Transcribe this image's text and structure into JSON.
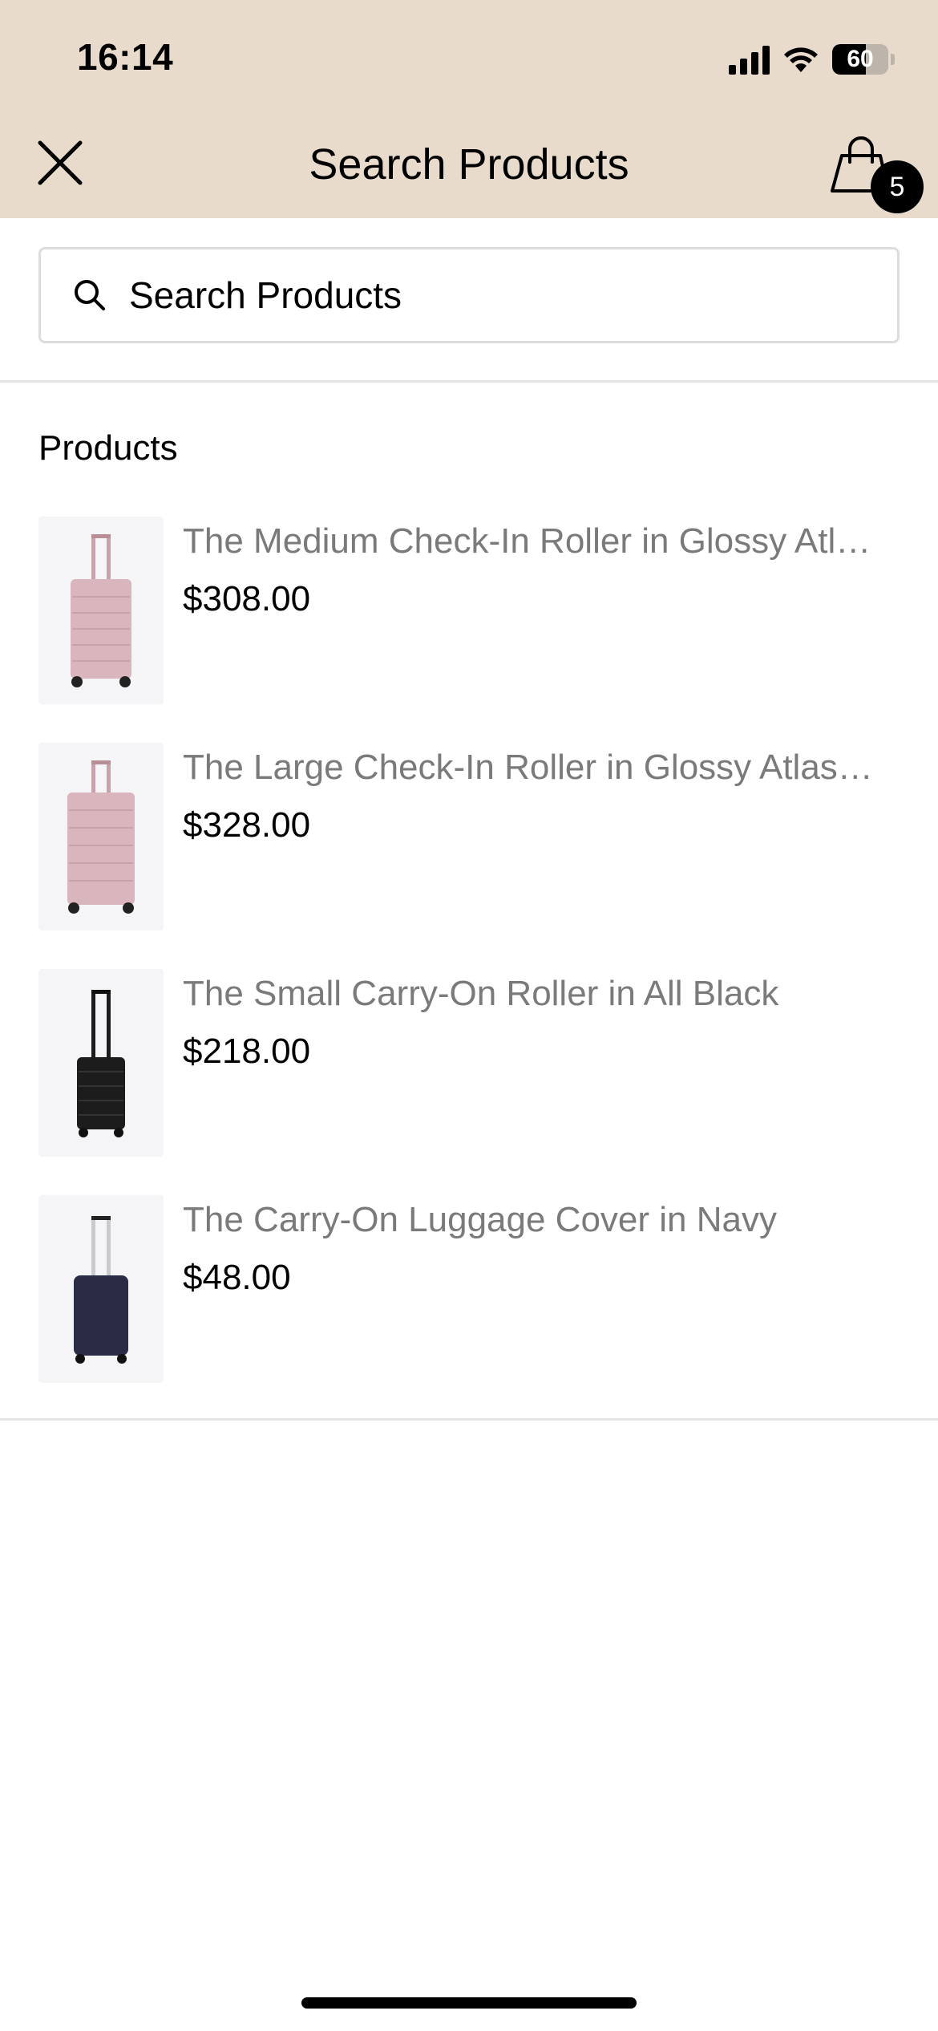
{
  "status_bar": {
    "time": "16:14",
    "battery": "60",
    "battery_level": 0.6
  },
  "header": {
    "title": "Search Products",
    "cart_count": "5"
  },
  "search": {
    "placeholder": "Search Products"
  },
  "section": {
    "title": "Products"
  },
  "products": [
    {
      "name": "The Medium Check-In Roller in Glossy Atl…",
      "price": "$308.00",
      "color": "#d9b5bd",
      "icon": "pink-suitcase"
    },
    {
      "name": "The Large Check-In Roller in Glossy Atlas…",
      "price": "$328.00",
      "color": "#d9b5bd",
      "icon": "pink-suitcase"
    },
    {
      "name": "The Small Carry-On Roller in All Black",
      "price": "$218.00",
      "color": "#1c1c1c",
      "icon": "black-suitcase"
    },
    {
      "name": "The Carry-On Luggage Cover in Navy",
      "price": "$48.00",
      "color": "#2a2c45",
      "icon": "navy-suitcase"
    }
  ],
  "colors": {
    "header_bg": "#e9dbcc",
    "muted_text": "#7a7a7a",
    "divider": "#e4e4e4"
  }
}
